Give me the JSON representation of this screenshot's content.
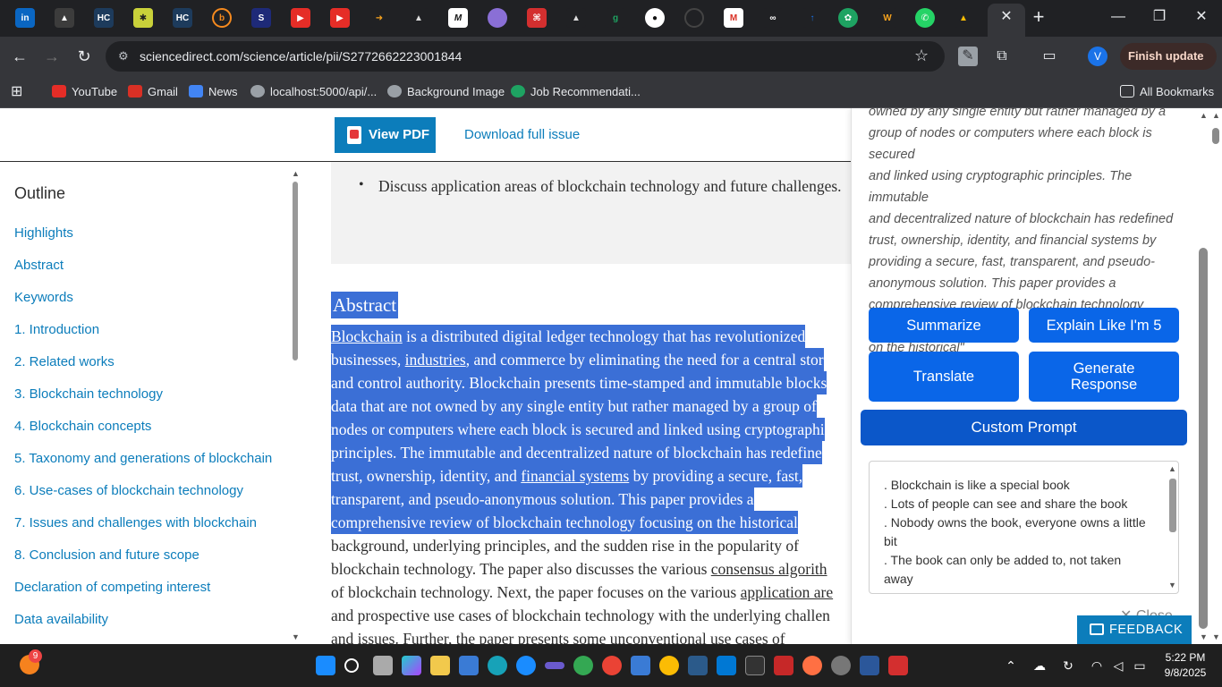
{
  "browser": {
    "tab_icons": [
      "linkedin-icon",
      "app-icon",
      "hc-icon",
      "asterisk-icon",
      "hc-icon",
      "b-icon",
      "app-icon",
      "youtube-icon",
      "youtube-icon",
      "arrow-icon",
      "drive-icon",
      "m-icon",
      "orb-icon",
      "pdf-icon",
      "drive-icon",
      "g-icon",
      "github-icon",
      "github-icon",
      "gmail-icon",
      "link-icon",
      "app-icon",
      "chat-icon",
      "app-icon",
      "whatsapp-icon",
      "drive-icon"
    ],
    "tab_labels": [
      "in",
      "",
      "HC",
      "",
      "HC",
      "b",
      "",
      "",
      "",
      "",
      "",
      "M",
      "",
      "",
      "",
      "",
      "",
      "",
      "M",
      "",
      "",
      "",
      "",
      "",
      ""
    ],
    "url": "sciencedirect.com/science/article/pii/S2772662223001844",
    "profile_initial": "V",
    "finish_update": "Finish update",
    "bookmarks": [
      "YouTube",
      "Gmail",
      "News",
      "localhost:5000/api/...",
      "Background Image",
      "Job Recommendati..."
    ],
    "all_bookmarks": "All Bookmarks"
  },
  "page": {
    "view_pdf": "View PDF",
    "download_issue": "Download full issue",
    "outline_title": "Outline",
    "outline_items": [
      "Highlights",
      "Abstract",
      "Keywords",
      "1. Introduction",
      "2. Related works",
      "3. Blockchain technology",
      "4. Blockchain concepts",
      "5. Taxonomy and generations of blockchain",
      "6. Use-cases of blockchain technology",
      "7. Issues and challenges with blockchain",
      "8. Conclusion and future scope",
      "Declaration of competing interest",
      "Data availability"
    ],
    "highlight_bullet": "Discuss application areas of blockchain technology and future challenges.",
    "abstract_heading": "Abstract",
    "abstract_lines": {
      "l1a": "Blockchain",
      "l1b": " is a distributed digital ledger technology that has revolutionized",
      "l2a": "businesses, ",
      "l2b": "industries",
      "l2c": ", and commerce by eliminating the need for a central stor",
      "l3": "and control authority. Blockchain presents time-stamped and immutable blocks",
      "l4": "data that are not owned by any single entity but rather managed by a group of",
      "l5": "nodes or computers where each block is secured and linked using cryptographi",
      "l6": "principles. The immutable and decentralized nature of blockchain has redefine",
      "l7a": "trust, ownership, identity, and ",
      "l7b": "financial systems",
      "l7c": " by providing a secure, fast,",
      "l8": "transparent, and pseudo-anonymous solution. This paper provides a",
      "l9": "comprehensive review of blockchain technology focusing on the historical",
      "l10": "background, underlying principles, and the sudden rise in the popularity of",
      "l11a": "blockchain technology. The paper also discusses the various ",
      "l11b": "consensus algorith",
      "l12a": "of blockchain technology. Next, the paper focuses on the various ",
      "l12b": "application are",
      "l13": "and prospective use cases of blockchain technology with the underlying challen",
      "l14": "and issues. Further, the paper presents some unconventional use cases of"
    }
  },
  "panel": {
    "quote_lines": [
      "owned by any single entity but rather managed by a",
      "group of nodes or computers where each block is secured",
      "and linked using cryptographic principles. The immutable",
      "and decentralized nature of blockchain has redefined",
      "trust, ownership, identity, and financial systems by",
      "providing a secure, fast, transparent, and pseudo-",
      "anonymous solution. This paper provides a",
      "comprehensive review of blockchain technology focusing",
      "on the historical\""
    ],
    "summarize": "Summarize",
    "explain": "Explain Like I'm 5",
    "translate": "Translate",
    "generate": "Generate Response",
    "custom_prompt": "Custom Prompt",
    "response_lines": [
      ". Blockchain is like a special book",
      ". Lots of people can see and share the book",
      ". Nobody owns the book, everyone owns a little bit",
      ". The book can only be added to, not taken away"
    ],
    "close": "✕ Close",
    "feedback": "FEEDBACK"
  },
  "taskbar": {
    "notification_count": "9",
    "time": "5:22 PM",
    "date": "9/8/2025"
  },
  "colors": {
    "accent": "#0c7dbb",
    "selection": "#3b6fd6",
    "panel_button": "#0a66e8"
  }
}
